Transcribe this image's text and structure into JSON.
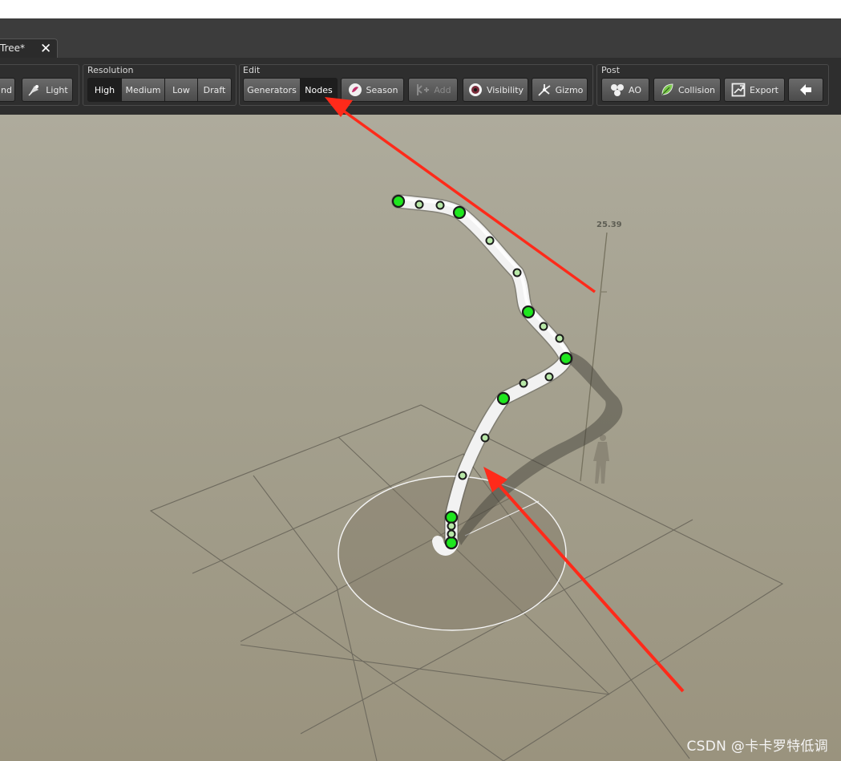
{
  "tab": {
    "title": "Tree*"
  },
  "toolbar": {
    "groups": {
      "left": {
        "wind_label": "nd",
        "light_label": "Light"
      },
      "resolution": {
        "title": "Resolution",
        "items": [
          "High",
          "Medium",
          "Low",
          "Draft"
        ],
        "selected": "High"
      },
      "edit": {
        "title": "Edit",
        "generators": "Generators",
        "nodes": "Nodes",
        "season": "Season",
        "add": "Add",
        "visibility": "Visibility",
        "gizmo": "Gizmo"
      },
      "post": {
        "title": "Post",
        "ao": "AO",
        "collision": "Collision",
        "export": "Export"
      }
    }
  },
  "viewport": {
    "height_marker": "25.39"
  },
  "watermark": "CSDN @卡卡罗特低调",
  "colors": {
    "node_green": "#1ee61e",
    "arrow_red": "#ff2a1a",
    "toolbar_bg": "#2e2e2e"
  }
}
